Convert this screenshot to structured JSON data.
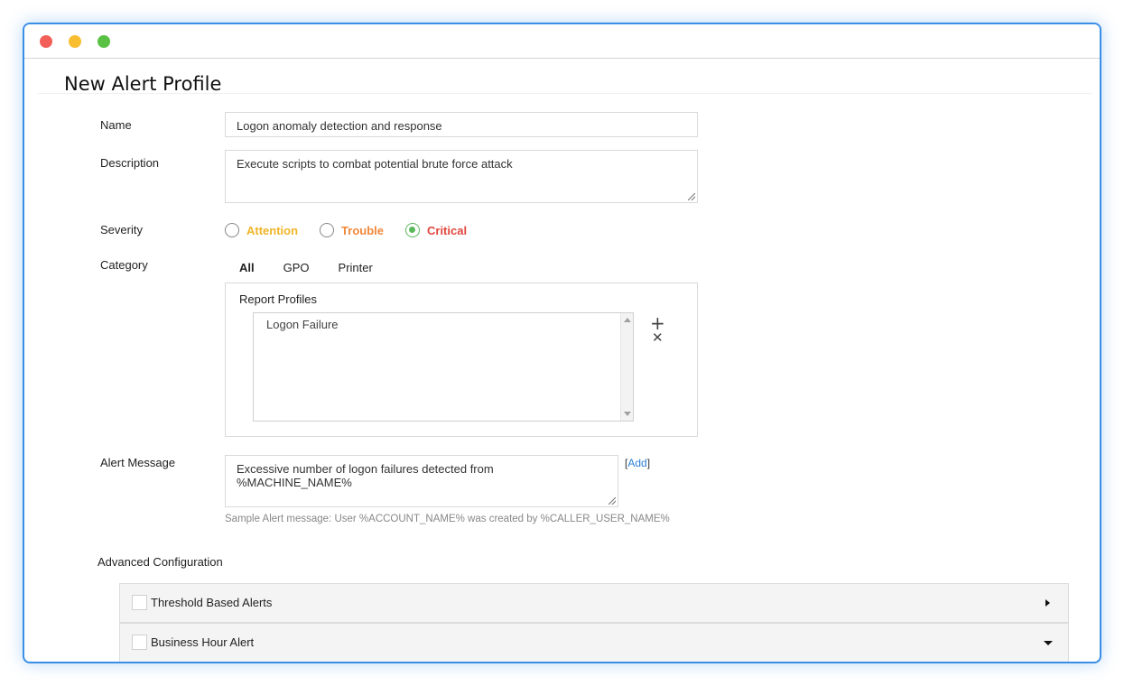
{
  "window": {
    "controls": [
      "close",
      "minimize",
      "maximize"
    ]
  },
  "page": {
    "title": "New Alert Profile"
  },
  "form": {
    "name": {
      "label": "Name",
      "value": "Logon anomaly detection and response"
    },
    "description": {
      "label": "Description",
      "value": "Execute scripts to combat potential brute force attack"
    },
    "severity": {
      "label": "Severity",
      "options": [
        {
          "label": "Attention",
          "color": "#f0b427",
          "selected": false
        },
        {
          "label": "Trouble",
          "color": "#f0883a",
          "selected": false
        },
        {
          "label": "Critical",
          "color": "#e0463c",
          "selected": true
        }
      ]
    },
    "category": {
      "label": "Category",
      "tabs": [
        {
          "label": "All",
          "active": true
        },
        {
          "label": "GPO",
          "active": false
        },
        {
          "label": "Printer",
          "active": false
        }
      ],
      "report_profiles_label": "Report Profiles",
      "report_profiles": [
        "Logon Failure"
      ],
      "add_icon": "plus-icon",
      "remove_icon": "close-icon"
    },
    "alert_message": {
      "label": "Alert Message",
      "value": "Excessive number of logon failures detected from %MACHINE_NAME%",
      "add_link_open": "[",
      "add_link_label": "Add",
      "add_link_close": "]",
      "sample": "Sample Alert message: User %ACCOUNT_NAME% was created by %CALLER_USER_NAME%"
    }
  },
  "advanced": {
    "label": "Advanced Configuration",
    "sections": [
      {
        "label": "Threshold Based Alerts",
        "checked": false,
        "expanded": false,
        "caret": "chevron-right-icon"
      },
      {
        "label": "Business Hour Alert",
        "checked": false,
        "expanded": true,
        "caret": "chevron-down-icon"
      }
    ]
  },
  "colors": {
    "accent": "#5cb85c",
    "window_border": "#3a8ee6",
    "link": "#2a7fd4"
  }
}
